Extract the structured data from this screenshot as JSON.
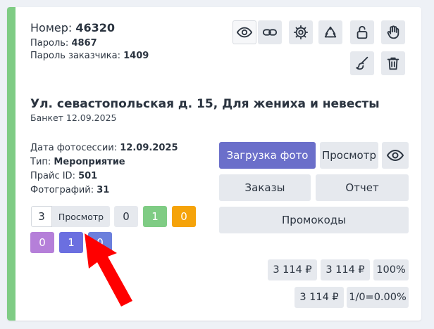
{
  "order": {
    "number_label": "Номер:",
    "number_value": "46320",
    "password_label": "Пароль:",
    "password_value": "4867",
    "client_password_label": "Пароль заказчика:",
    "client_password_value": "1409"
  },
  "toolbar": {
    "icons": [
      "eye-icon",
      "link-icon",
      "gear-icon",
      "recycle-icon",
      "unlock-icon",
      "hand-icon",
      "brush-icon",
      "trash-icon"
    ]
  },
  "event": {
    "title": "Ул. севастопольская д. 15, Для жениха и невесты",
    "subtitle": "Банкет 12.09.2025"
  },
  "details": {
    "date_label": "Дата фотосессии:",
    "date_value": "12.09.2025",
    "type_label": "Тип:",
    "type_value": "Мероприятие",
    "price_id_label": "Прайс ID:",
    "price_id_value": "501",
    "photos_label": "Фотографий:",
    "photos_value": "31"
  },
  "actions": {
    "upload": "Загрузка фото",
    "view": "Просмотр",
    "orders": "Заказы",
    "report": "Отчет",
    "promocodes": "Промокоды"
  },
  "quantity": {
    "value": "3",
    "button": "Просмотр"
  },
  "badges": [
    {
      "value": "0",
      "color": "#e6e9ee",
      "text_color": "#2b3440"
    },
    {
      "value": "1",
      "color": "#7fcc84",
      "text_color": "#ffffff"
    },
    {
      "value": "0",
      "color": "#f5a30a",
      "text_color": "#ffffff"
    },
    {
      "value": "0",
      "color": "#b57fd9",
      "text_color": "#ffffff"
    },
    {
      "value": "1",
      "color": "#6b6fe0",
      "text_color": "#ffffff"
    },
    {
      "value": "0",
      "color": "#6b7fdc",
      "text_color": "#ffffff"
    }
  ],
  "prices": {
    "p1": "3 114 ₽",
    "p2": "3 114 ₽",
    "percent": "100%",
    "p3": "3 114 ₽",
    "ratio": "1/0=0.00%"
  },
  "colors": {
    "accent": "#7fcc84",
    "primary": "#6b6fca",
    "arrow": "#ff0000"
  }
}
